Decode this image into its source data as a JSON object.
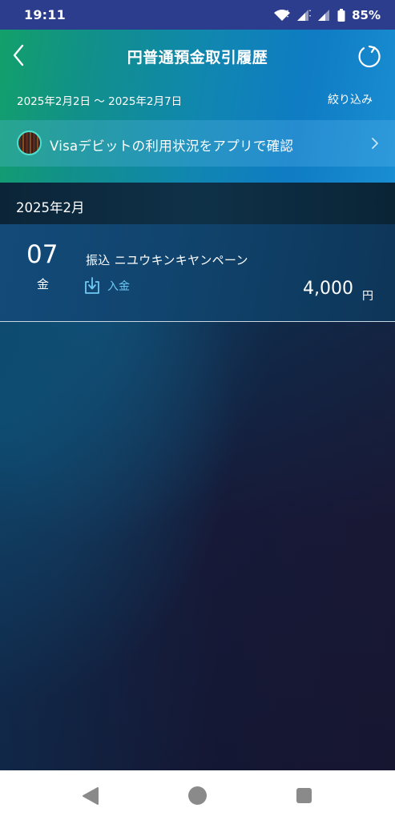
{
  "status_bar": {
    "time": "19:11",
    "battery_percent": "85%",
    "icons": [
      "wifi-icon",
      "signal-icon",
      "signal-icon",
      "battery-icon"
    ]
  },
  "header": {
    "title": "円普通預金取引履歴",
    "period": "2025年2月2日 ～ 2025年2月7日",
    "filter_label": "絞り込み",
    "back_icon": "chevron-left-icon",
    "refresh_icon": "refresh-icon"
  },
  "visa_banner": {
    "label": "Visaデビットの利用状況をアプリで確認",
    "icon": "chevron-right-icon"
  },
  "month": {
    "label": "2025年2月"
  },
  "transactions": [
    {
      "day": "07",
      "weekday": "金",
      "description": "振込 ニユウキンキヤンペーン",
      "type": "入金",
      "type_icon": "deposit-icon",
      "amount": "4,000",
      "currency": "円"
    }
  ],
  "nav_bar": {
    "icons": [
      "nav-back-icon",
      "nav-home-icon",
      "nav-recents-icon"
    ]
  },
  "colors": {
    "status_bar_bg": "#2c3d8d",
    "header_gradient_start": "#13a06a",
    "header_gradient_end": "#1a8ed2",
    "deposit_accent": "#6fc8f5",
    "nav_icons": "#8a8a8a"
  }
}
